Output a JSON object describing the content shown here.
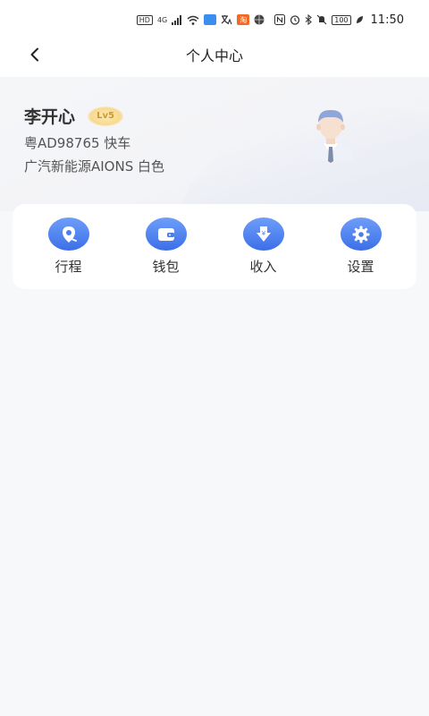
{
  "status_bar": {
    "hd": "HD",
    "net": "4G",
    "app_text": "淘",
    "battery": "100",
    "time": "11:50"
  },
  "nav": {
    "title": "个人中心"
  },
  "profile": {
    "name": "李开心",
    "level": "Lv5",
    "plate": "粤AD98765 快车",
    "car": "广汽新能源AIONS 白色"
  },
  "menu": [
    {
      "label": "行程",
      "icon": "location-pin-icon"
    },
    {
      "label": "钱包",
      "icon": "wallet-icon"
    },
    {
      "label": "收入",
      "icon": "income-icon"
    },
    {
      "label": "设置",
      "icon": "gear-icon"
    }
  ],
  "colors": {
    "accent_blue": "#4a7ef0",
    "badge_gold": "#c99a33"
  }
}
